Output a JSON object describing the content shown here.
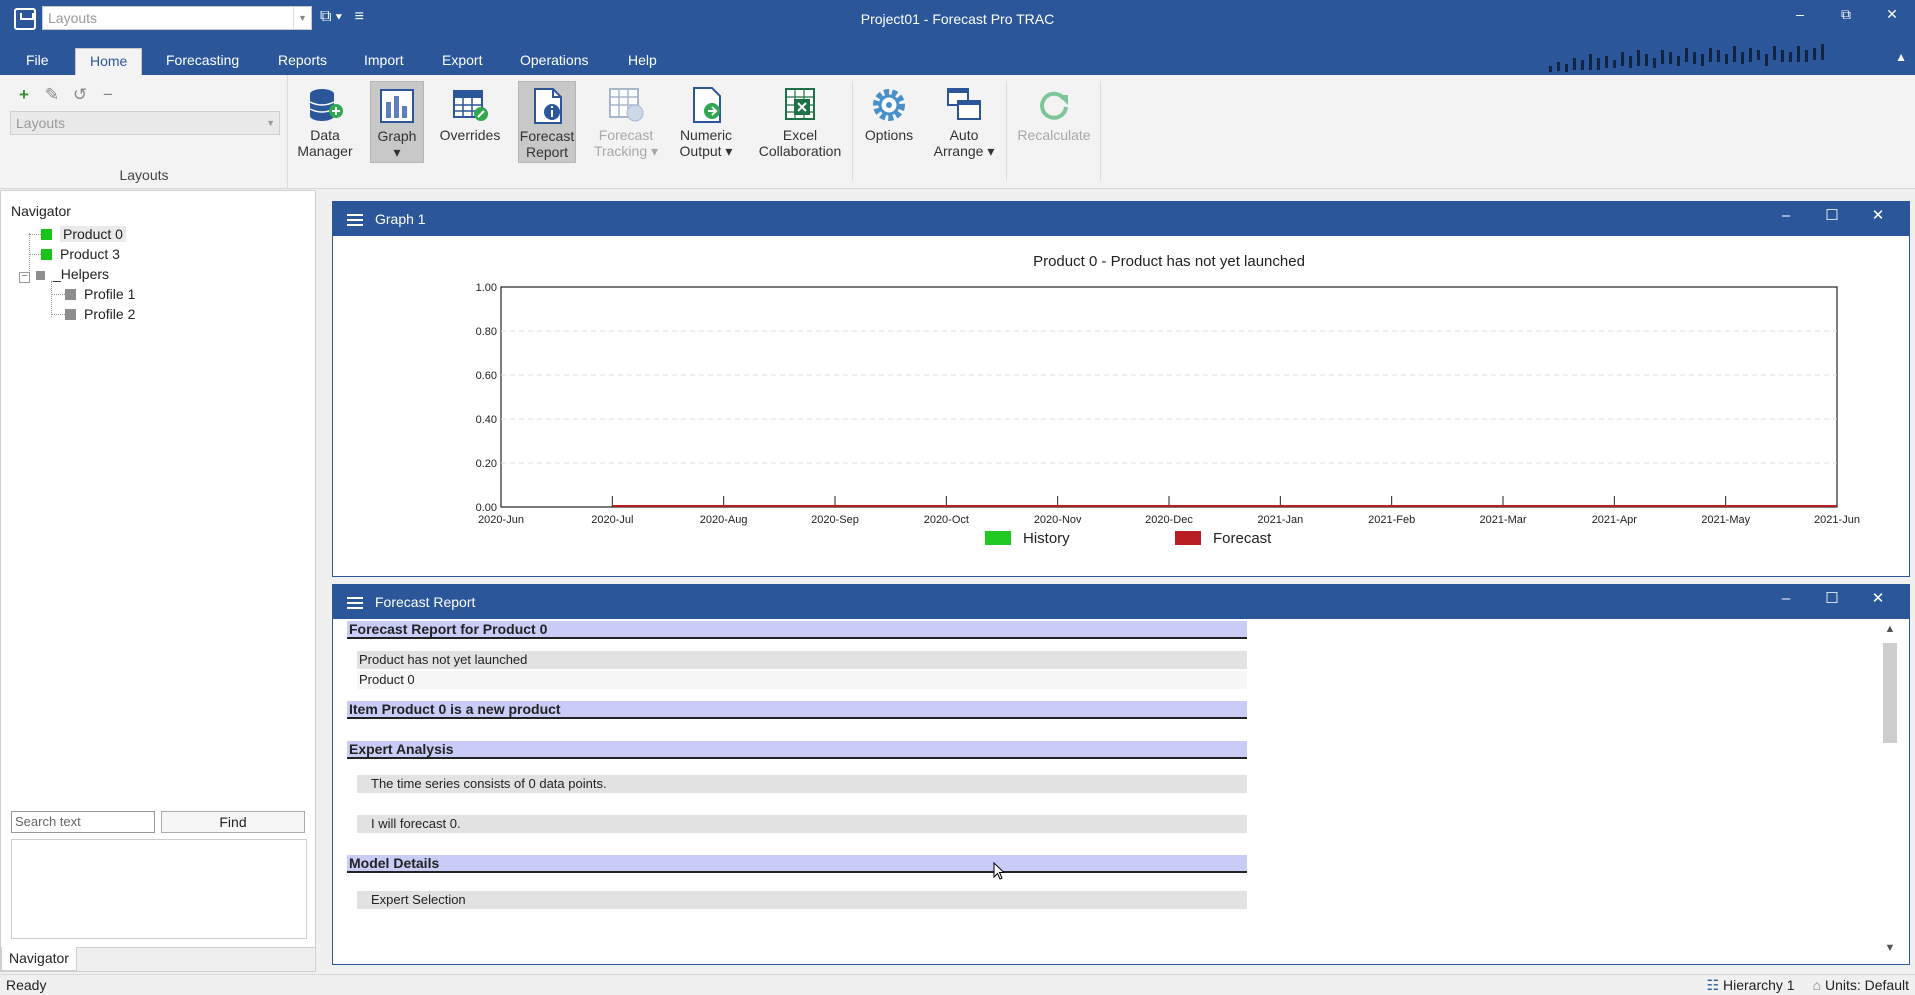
{
  "window": {
    "title": "Project01 - Forecast Pro TRAC",
    "layout_combo": "Layouts",
    "qat": "▾ ≡",
    "controls": {
      "minimize": "–",
      "restore": "⧉",
      "close": "✕"
    }
  },
  "menu": [
    "File",
    "Home",
    "Forecasting",
    "Reports",
    "Import",
    "Export",
    "Operations",
    "Help"
  ],
  "ribbon": {
    "layouts_group": {
      "combo": "Layouts",
      "label": "Layouts"
    },
    "buttons": [
      {
        "line1": "Data",
        "line2": "Manager"
      },
      {
        "line1": "Graph",
        "line2": "▾"
      },
      {
        "line1": "Overrides",
        "line2": ""
      },
      {
        "line1": "Forecast",
        "line2": "Report"
      },
      {
        "line1": "Forecast",
        "line2": "Tracking ▾"
      },
      {
        "line1": "Numeric",
        "line2": "Output ▾"
      },
      {
        "line1": "Excel",
        "line2": "Collaboration"
      },
      {
        "line1": "Options",
        "line2": ""
      },
      {
        "line1": "Auto",
        "line2": "Arrange ▾"
      },
      {
        "line1": "Recalculate",
        "line2": ""
      }
    ]
  },
  "navigator": {
    "title": "Navigator",
    "items": [
      {
        "label": "Product 0",
        "color": "#18c418"
      },
      {
        "label": "Product 3",
        "color": "#18c418"
      },
      {
        "label": "_Helpers",
        "color": "#8d8d8d"
      },
      {
        "label": "Profile 1",
        "color": "#8d8d8d"
      },
      {
        "label": "Profile 2",
        "color": "#8d8d8d"
      }
    ],
    "search_placeholder": "Search text",
    "find_label": "Find",
    "tab_label": "Navigator"
  },
  "graph_window": {
    "title": "Graph 1"
  },
  "chart_data": {
    "type": "line",
    "title": "Product 0 - Product has not yet launched",
    "x": [
      "2020-Jun",
      "2020-Jul",
      "2020-Aug",
      "2020-Sep",
      "2020-Oct",
      "2020-Nov",
      "2020-Dec",
      "2021-Jan",
      "2021-Feb",
      "2021-Mar",
      "2021-Apr",
      "2021-May",
      "2021-Jun"
    ],
    "yticks": [
      "1.00",
      "0.80",
      "0.60",
      "0.40",
      "0.20",
      "0.00"
    ],
    "ylim": [
      0,
      1
    ],
    "series": [
      {
        "name": "History",
        "color": "#22c922",
        "values": []
      },
      {
        "name": "Forecast",
        "color": "#b81e24",
        "values": [
          0,
          0,
          0,
          0,
          0,
          0,
          0,
          0,
          0,
          0,
          0,
          0
        ]
      }
    ],
    "grid": true,
    "legend": "bottom"
  },
  "report_window": {
    "title": "Forecast Report",
    "h1": "Forecast Report for Product 0",
    "r1": "Product has not yet launched",
    "r2": "Product 0",
    "h2": "Item Product 0 is a new product",
    "h3": "Expert Analysis",
    "r3": "The time series consists of 0 data points.",
    "r4": "I will forecast 0.",
    "h4": "Model Details",
    "r5": "Expert Selection"
  },
  "status": {
    "left": "Ready",
    "hierarchy": "Hierarchy 1",
    "units": "Units: Default"
  }
}
